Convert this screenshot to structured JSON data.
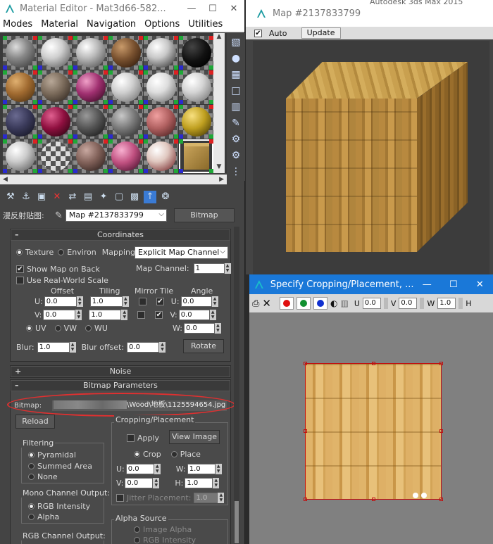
{
  "material_editor": {
    "title": "Material Editor - Mat3d66-582...",
    "menus": [
      "Modes",
      "Material",
      "Navigation",
      "Options",
      "Utilities"
    ],
    "map_label": "漫反射贴图:",
    "map_name": "Map #2137833799",
    "map_type": "Bitmap",
    "coordinates": {
      "title": "Coordinates",
      "texture": "Texture",
      "environ": "Environ",
      "mapping_label": "Mapping:",
      "mapping_value": "Explicit Map Channel",
      "show_map_on_back": "Show Map on Back",
      "map_channel_label": "Map Channel:",
      "map_channel_value": "1",
      "real_world": "Use Real-World Scale",
      "offset": "Offset",
      "tiling": "Tiling",
      "mirror_tile": "Mirror Tile",
      "angle": "Angle",
      "u_label": "U:",
      "v_label": "V:",
      "w_label": "W:",
      "u_offset": "0.0",
      "v_offset": "0.0",
      "u_tiling": "1.0",
      "v_tiling": "1.0",
      "u_angle": "0.0",
      "v_angle": "0.0",
      "w_angle": "0.0",
      "uv": "UV",
      "vw": "VW",
      "wu": "WU",
      "blur_label": "Blur:",
      "blur_value": "1.0",
      "blur_offset_label": "Blur offset:",
      "blur_offset_value": "0.0",
      "rotate": "Rotate"
    },
    "noise": {
      "title": "Noise"
    },
    "bitmap_parameters": {
      "title": "Bitmap Parameters",
      "bitmap_label": "Bitmap:",
      "bitmap_path": "\\Wood\\地板\\1125594654.jpg",
      "reload": "Reload",
      "cropping_title": "Cropping/Placement",
      "apply": "Apply",
      "view_image": "View Image",
      "crop": "Crop",
      "place": "Place",
      "u_label": "U:",
      "v_label": "V:",
      "w_label": "W:",
      "h_label": "H:",
      "u_value": "0.0",
      "v_value": "0.0",
      "w_value": "1.0",
      "h_value": "1.0",
      "jitter_label": "Jitter Placement:",
      "jitter_value": "1.0",
      "filtering_title": "Filtering",
      "filter_pyramidal": "Pyramidal",
      "filter_summed": "Summed Area",
      "filter_none": "None",
      "mono_title": "Mono Channel Output:",
      "mono_rgb": "RGB Intensity",
      "mono_alpha": "Alpha",
      "rgb_title": "RGB Channel Output:",
      "alpha_source_title": "Alpha Source",
      "alpha_image": "Image Alpha",
      "alpha_rgb": "RGB Intensity"
    }
  },
  "map_window": {
    "title": "Map #2137833799",
    "auto": "Auto",
    "update": "Update"
  },
  "app_title_fragment": "Autodesk 3ds Max 2015",
  "crop_window": {
    "title": "Specify Cropping/Placement, ...",
    "u_label": "U",
    "v_label": "V",
    "w_label": "W",
    "h_label": "H",
    "u_value": "0.0",
    "v_value": "0.0",
    "w_value": "1.0"
  },
  "colors": {
    "title_blue": "#1a78d8",
    "highlight_red": "#e03030",
    "panel_bg": "#4a4a4a"
  }
}
